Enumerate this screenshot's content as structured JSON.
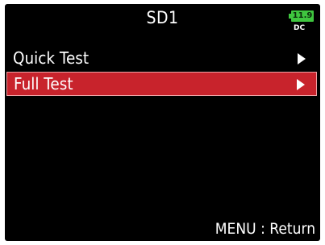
{
  "header": {
    "title": "SD1",
    "battery_value": "11.9",
    "power_source": "DC",
    "battery_color": "#3fc63f"
  },
  "menu": {
    "items": [
      {
        "label": "Quick Test",
        "selected": false,
        "icon": "play-arrow-icon"
      },
      {
        "label": "Full Test",
        "selected": true,
        "icon": "play-arrow-icon"
      }
    ],
    "highlight_color": "#c8232c"
  },
  "footer": {
    "hint": "MENU : Return"
  }
}
